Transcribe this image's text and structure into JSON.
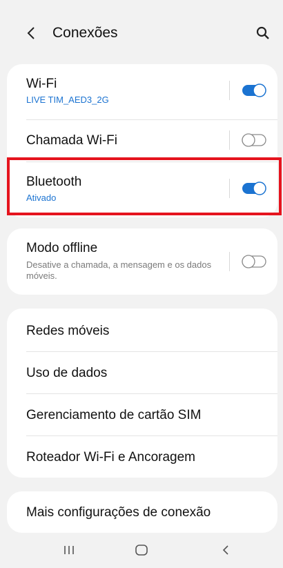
{
  "header": {
    "title": "Conexões",
    "back_icon": "chevron-left-icon",
    "search_icon": "search-icon"
  },
  "connections": {
    "wifi": {
      "label": "Wi-Fi",
      "status": "LIVE TIM_AED3_2G",
      "enabled": true
    },
    "wifi_calling": {
      "label": "Chamada Wi-Fi",
      "enabled": false
    },
    "bluetooth": {
      "label": "Bluetooth",
      "status": "Ativado",
      "enabled": true
    }
  },
  "offline": {
    "label": "Modo offline",
    "description": "Desative a chamada, a mensagem e os dados móveis.",
    "enabled": false
  },
  "menu": {
    "items": [
      {
        "label": "Redes móveis"
      },
      {
        "label": "Uso de dados"
      },
      {
        "label": "Gerenciamento de cartão SIM"
      },
      {
        "label": "Roteador Wi-Fi e Ancoragem"
      }
    ]
  },
  "more": {
    "label": "Mais configurações de conexão"
  },
  "navbar": {
    "recent_icon": "recent-apps-icon",
    "home_icon": "home-icon",
    "back_icon": "back-icon"
  },
  "colors": {
    "accent": "#1b73d1",
    "highlight": "#e5141e",
    "background": "#f2f2f2"
  }
}
